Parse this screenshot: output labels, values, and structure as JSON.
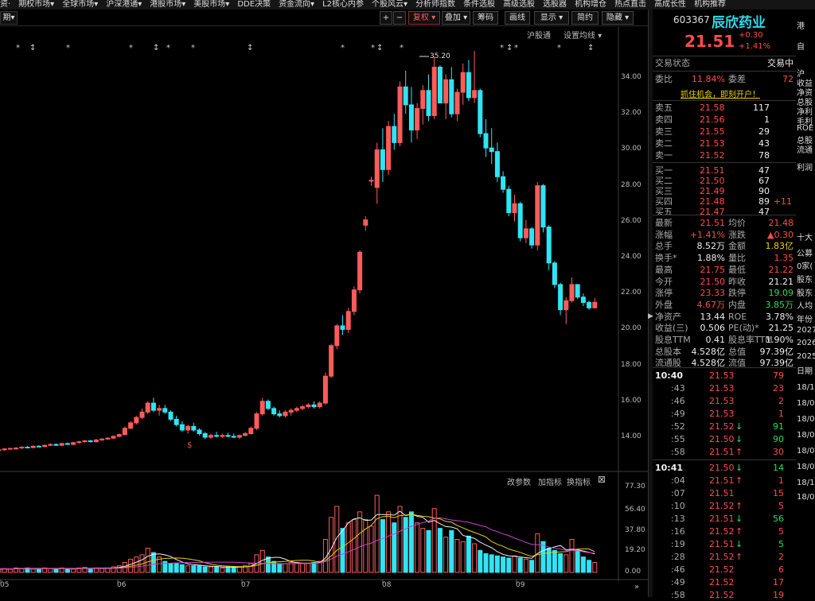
{
  "menu": [
    "资·",
    "期权市场▾",
    "全球市场▾",
    "沪深港通▾",
    "港股市场▾",
    "美股市场▾",
    "DDE决策",
    "资金流向▾",
    "L2核心内参",
    "个股风云▾",
    "分析师指数",
    "条件选股",
    "高级选股",
    "选股器",
    "机构增仓",
    "热点直击",
    "高成长性",
    "机构推荐"
  ],
  "toolbar": {
    "period": "期▾",
    "plus": "+",
    "minus": "−",
    "fuquan": "复权 ▾",
    "overlay": "叠加 ▾",
    "chips": "筹码",
    "draw": "画线",
    "display": "显示 ▾",
    "simple": "简约",
    "hide": "隐藏 ▾"
  },
  "sub": {
    "hgt": "沪股通",
    "setma": "设置均线 ▾",
    "gaicanshu": "改参数",
    "addind": "加指标",
    "swapind": "换指标",
    "close": "⊠"
  },
  "price_axis": [
    "34.00",
    "32.00",
    "30.00",
    "28.00",
    "26.00",
    "24.00",
    "22.00",
    "20.00",
    "18.00",
    "16.00",
    "14.00"
  ],
  "vol_axis": [
    "77.30",
    "56.40",
    "37.80",
    "19.20",
    "0.00"
  ],
  "months": [
    "05",
    "06",
    "07",
    "08",
    "09"
  ],
  "peak_label": "35.20",
  "dollar": "$",
  "chart_data": {
    "type": "candlestick",
    "candles": [
      [
        13.3,
        13.35,
        13.2,
        13.3
      ],
      [
        13.3,
        13.4,
        13.25,
        13.35
      ],
      [
        13.35,
        13.4,
        13.3,
        13.38
      ],
      [
        13.35,
        13.45,
        13.3,
        13.4
      ],
      [
        13.4,
        13.5,
        13.35,
        13.45
      ],
      [
        13.45,
        13.5,
        13.38,
        13.42
      ],
      [
        13.42,
        13.55,
        13.4,
        13.5
      ],
      [
        13.5,
        13.55,
        13.45,
        13.48
      ],
      [
        13.48,
        13.6,
        13.45,
        13.55
      ],
      [
        13.55,
        13.65,
        13.5,
        13.6
      ],
      [
        13.6,
        13.65,
        13.52,
        13.55
      ],
      [
        13.55,
        13.7,
        13.5,
        13.65
      ],
      [
        13.65,
        13.7,
        13.58,
        13.6
      ],
      [
        13.6,
        13.75,
        13.55,
        13.7
      ],
      [
        13.7,
        13.8,
        13.65,
        13.75
      ],
      [
        13.75,
        13.85,
        13.7,
        13.8
      ],
      [
        13.8,
        13.85,
        13.72,
        13.75
      ],
      [
        13.75,
        13.9,
        13.7,
        13.85
      ],
      [
        13.85,
        13.95,
        13.8,
        13.9
      ],
      [
        13.9,
        14.0,
        13.85,
        13.95
      ],
      [
        13.95,
        14.1,
        13.9,
        14.05
      ],
      [
        14.05,
        14.2,
        14.0,
        14.15
      ],
      [
        14.15,
        14.6,
        14.1,
        14.5
      ],
      [
        14.5,
        14.9,
        14.45,
        14.8
      ],
      [
        14.8,
        15.2,
        14.7,
        15.1
      ],
      [
        15.1,
        15.6,
        15.0,
        15.4
      ],
      [
        15.4,
        16.0,
        15.3,
        15.9
      ],
      [
        15.9,
        16.2,
        15.4,
        15.5
      ],
      [
        15.5,
        15.8,
        15.2,
        15.6
      ],
      [
        15.6,
        15.8,
        15.3,
        15.4
      ],
      [
        15.4,
        15.5,
        14.9,
        15.0
      ],
      [
        15.0,
        15.2,
        14.6,
        14.7
      ],
      [
        14.7,
        14.9,
        14.3,
        14.4
      ],
      [
        14.4,
        14.7,
        14.2,
        14.6
      ],
      [
        14.6,
        14.8,
        14.3,
        14.4
      ],
      [
        14.4,
        14.5,
        14.1,
        14.2
      ],
      [
        14.2,
        14.3,
        13.9,
        14.0
      ],
      [
        14.0,
        14.2,
        13.9,
        14.1
      ],
      [
        14.1,
        14.3,
        14.0,
        14.05
      ],
      [
        14.05,
        14.2,
        13.95,
        14.1
      ],
      [
        14.1,
        14.25,
        14.0,
        14.05
      ],
      [
        14.05,
        14.2,
        13.95,
        14.0
      ],
      [
        14.0,
        14.15,
        13.9,
        14.1
      ],
      [
        14.1,
        14.3,
        14.05,
        14.2
      ],
      [
        14.2,
        14.6,
        14.15,
        14.5
      ],
      [
        14.5,
        15.4,
        14.4,
        15.3
      ],
      [
        15.3,
        16.2,
        15.2,
        16.0
      ],
      [
        16.0,
        16.1,
        15.5,
        15.6
      ],
      [
        15.6,
        15.7,
        15.2,
        15.3
      ],
      [
        15.3,
        15.5,
        15.1,
        15.2
      ],
      [
        15.2,
        15.5,
        15.1,
        15.4
      ],
      [
        15.4,
        15.6,
        15.2,
        15.5
      ],
      [
        15.5,
        15.7,
        15.4,
        15.6
      ],
      [
        15.6,
        15.8,
        15.5,
        15.7
      ],
      [
        15.7,
        15.9,
        15.6,
        15.8
      ],
      [
        15.8,
        16.0,
        15.6,
        15.7
      ],
      [
        15.7,
        16.0,
        15.6,
        15.9
      ],
      [
        15.9,
        17.6,
        15.8,
        17.4
      ],
      [
        17.4,
        19.2,
        17.3,
        19.1
      ],
      [
        19.1,
        20.3,
        18.9,
        20.2
      ],
      [
        20.2,
        20.8,
        19.7,
        20.0
      ],
      [
        20.0,
        21.2,
        19.8,
        21.0
      ],
      [
        21.0,
        22.4,
        20.8,
        22.2
      ],
      [
        22.2,
        24.4,
        22.0,
        24.3
      ],
      [
        25.8,
        26.3,
        25.5,
        26.1
      ],
      [
        28.3,
        28.5,
        28.0,
        28.3
      ],
      [
        27.9,
        30.4,
        27.0,
        30.0
      ],
      [
        30.0,
        31.2,
        28.2,
        28.9
      ],
      [
        28.9,
        31.6,
        28.6,
        31.3
      ],
      [
        31.3,
        32.0,
        30.0,
        30.4
      ],
      [
        30.4,
        33.8,
        30.2,
        33.5
      ],
      [
        33.5,
        34.4,
        32.0,
        32.5
      ],
      [
        32.5,
        33.5,
        30.4,
        31.1
      ],
      [
        31.1,
        32.6,
        30.6,
        32.3
      ],
      [
        32.3,
        33.6,
        31.4,
        33.3
      ],
      [
        33.3,
        34.2,
        31.6,
        31.9
      ],
      [
        31.9,
        35.2,
        31.7,
        34.6
      ],
      [
        34.6,
        34.7,
        32.6,
        32.6
      ],
      [
        32.6,
        34.2,
        31.7,
        33.9
      ],
      [
        33.9,
        34.6,
        31.8,
        32.0
      ],
      [
        32.0,
        33.4,
        31.6,
        33.2
      ],
      [
        33.2,
        34.8,
        32.5,
        34.3
      ],
      [
        34.3,
        35.0,
        32.7,
        32.9
      ],
      [
        32.9,
        35.5,
        32.6,
        33.3
      ],
      [
        33.3,
        33.4,
        30.7,
        30.9
      ],
      [
        30.9,
        31.7,
        29.6,
        30.1
      ],
      [
        30.1,
        31.2,
        29.2,
        29.9
      ],
      [
        29.9,
        30.4,
        28.2,
        28.5
      ],
      [
        28.5,
        28.8,
        27.6,
        27.8
      ],
      [
        27.8,
        28.0,
        26.3,
        26.5
      ],
      [
        26.5,
        27.5,
        26.0,
        27.0
      ],
      [
        27.0,
        27.1,
        24.9,
        25.1
      ],
      [
        25.1,
        26.1,
        24.8,
        25.6
      ],
      [
        25.6,
        25.7,
        24.5,
        24.7
      ],
      [
        24.7,
        28.2,
        24.4,
        28.0
      ],
      [
        28.0,
        28.1,
        25.4,
        25.7
      ],
      [
        25.7,
        25.8,
        23.3,
        23.7
      ],
      [
        23.7,
        23.8,
        22.3,
        22.5
      ],
      [
        22.5,
        22.6,
        20.8,
        21.1
      ],
      [
        21.1,
        21.8,
        20.3,
        21.6
      ],
      [
        21.6,
        22.9,
        21.5,
        22.5
      ],
      [
        22.5,
        22.5,
        21.7,
        21.8
      ],
      [
        21.8,
        22.0,
        21.3,
        21.5
      ],
      [
        21.5,
        21.6,
        21.1,
        21.2
      ],
      [
        21.2,
        21.75,
        21.2,
        21.51
      ]
    ],
    "volume": [
      3,
      3.5,
      3,
      4,
      3.5,
      4,
      3,
      3.5,
      4,
      3.5,
      3,
      4,
      3.5,
      3,
      4,
      4.5,
      3.5,
      4,
      3.5,
      4,
      5,
      6,
      9,
      12,
      14,
      16,
      22,
      18,
      14,
      10,
      8,
      8,
      7,
      6,
      6,
      6,
      5,
      5,
      5,
      4,
      5,
      5,
      5,
      6,
      8,
      16,
      20,
      14,
      10,
      8,
      8,
      9,
      9,
      8,
      8,
      9,
      10,
      30,
      50,
      60,
      40,
      45,
      48,
      55,
      48,
      42,
      70,
      48,
      55,
      45,
      60,
      50,
      55,
      45,
      40,
      38,
      58,
      40,
      32,
      38,
      30,
      28,
      33,
      26,
      20,
      17,
      16,
      15,
      14,
      13,
      15,
      13,
      12,
      11,
      35,
      28,
      22,
      20,
      17,
      16,
      30,
      20,
      14,
      11,
      9
    ],
    "volume_label_max": "77.30"
  },
  "quote": {
    "code": "603367",
    "name": "辰欣药业",
    "price": "21.51",
    "change": "+0.30",
    "pct": "+1.41%"
  },
  "status": {
    "label": "交易状态",
    "value": "交易中"
  },
  "weibi": {
    "wb_label": "委比",
    "wb": "11.84%",
    "wc_label": "委差",
    "wc": "72"
  },
  "banner": "抓住机会，即刻开户！",
  "asks": [
    {
      "l": "卖五",
      "p": "21.58",
      "v": "117"
    },
    {
      "l": "卖四",
      "p": "21.56",
      "v": "1"
    },
    {
      "l": "卖三",
      "p": "21.55",
      "v": "29"
    },
    {
      "l": "卖二",
      "p": "21.53",
      "v": "43"
    },
    {
      "l": "卖一",
      "p": "21.52",
      "v": "78"
    }
  ],
  "bids": [
    {
      "l": "买一",
      "p": "21.51",
      "v": "47",
      "c": ""
    },
    {
      "l": "买二",
      "p": "21.50",
      "v": "67",
      "c": ""
    },
    {
      "l": "买三",
      "p": "21.49",
      "v": "90",
      "c": ""
    },
    {
      "l": "买四",
      "p": "21.48",
      "v": "89",
      "c": "+11"
    },
    {
      "l": "买五",
      "p": "21.47",
      "v": "47",
      "c": ""
    }
  ],
  "stats": [
    [
      "最新",
      "21.51",
      "均价",
      "21.48"
    ],
    [
      "涨幅",
      "+1.41%",
      "涨跌",
      "▲0.30"
    ],
    [
      "总手",
      "8.52万",
      "金额",
      "1.83亿"
    ],
    [
      "换手*",
      "1.88%",
      "量比",
      "1.35"
    ],
    [
      "最高",
      "21.75",
      "最低",
      "21.22"
    ],
    [
      "今开",
      "21.50",
      "昨收",
      "21.21"
    ],
    [
      "涨停",
      "23.33",
      "跌停",
      "19.09"
    ],
    [
      "外盘",
      "4.67万",
      "内盘",
      "3.85万"
    ],
    [
      "净资产",
      "13.44",
      "ROE",
      "3.78%"
    ],
    [
      "收益(三)",
      "0.506",
      "PE(动)*",
      "21.25"
    ],
    [
      "股息TTM",
      "0.41",
      "股息率TTM",
      "1.90%"
    ],
    [
      "总股本",
      "4.528亿",
      "总值",
      "97.39亿"
    ],
    [
      "流通股",
      "4.528亿",
      "流值",
      "97.39亿"
    ]
  ],
  "ticks": [
    {
      "t": "10:40",
      "p": "21.53",
      "a": "",
      "v": "79"
    },
    {
      "t": ":43",
      "p": "21.53",
      "a": "",
      "v": "23"
    },
    {
      "t": ":46",
      "p": "21.53",
      "a": "",
      "v": "2"
    },
    {
      "t": ":49",
      "p": "21.53",
      "a": "",
      "v": "1"
    },
    {
      "t": ":52",
      "p": "21.52",
      "a": "↓",
      "v": "91"
    },
    {
      "t": ":55",
      "p": "21.50",
      "a": "↓",
      "v": "90"
    },
    {
      "t": ":58",
      "p": "21.51",
      "a": "↑",
      "v": "30"
    },
    {
      "t": "10:41",
      "p": "21.50",
      "a": "↓",
      "v": "14"
    },
    {
      "t": ":04",
      "p": "21.51",
      "a": "↑",
      "v": "1"
    },
    {
      "t": ":07",
      "p": "21.51",
      "a": "",
      "v": "15"
    },
    {
      "t": ":10",
      "p": "21.52",
      "a": "↑",
      "v": "5"
    },
    {
      "t": ":13",
      "p": "21.51",
      "a": "↓",
      "v": "56"
    },
    {
      "t": ":16",
      "p": "21.52",
      "a": "↑",
      "v": "5"
    },
    {
      "t": ":19",
      "p": "21.51",
      "a": "↓",
      "v": "5"
    },
    {
      "t": ":28",
      "p": "21.52",
      "a": "↑",
      "v": "2"
    },
    {
      "t": ":46",
      "p": "21.52",
      "a": "",
      "v": "6"
    },
    {
      "t": ":49",
      "p": "21.52",
      "a": "",
      "v": "17"
    },
    {
      "t": ":58",
      "p": "21.52",
      "a": "",
      "v": "19"
    }
  ],
  "farcol": [
    "港",
    "自",
    "沪",
    "收益",
    "净资",
    "总股",
    "净利",
    "毛利",
    "ROE",
    "总股",
    "流通",
    "利润",
    "十大",
    "公募",
    "0家(",
    "股东",
    "股东",
    "人均",
    "年份",
    "2027",
    "2026",
    "2025",
    "日期",
    "18/1",
    "18/0",
    "18/0",
    "18/0",
    "18/0",
    "18/0",
    "18/1",
    "18/0"
  ]
}
